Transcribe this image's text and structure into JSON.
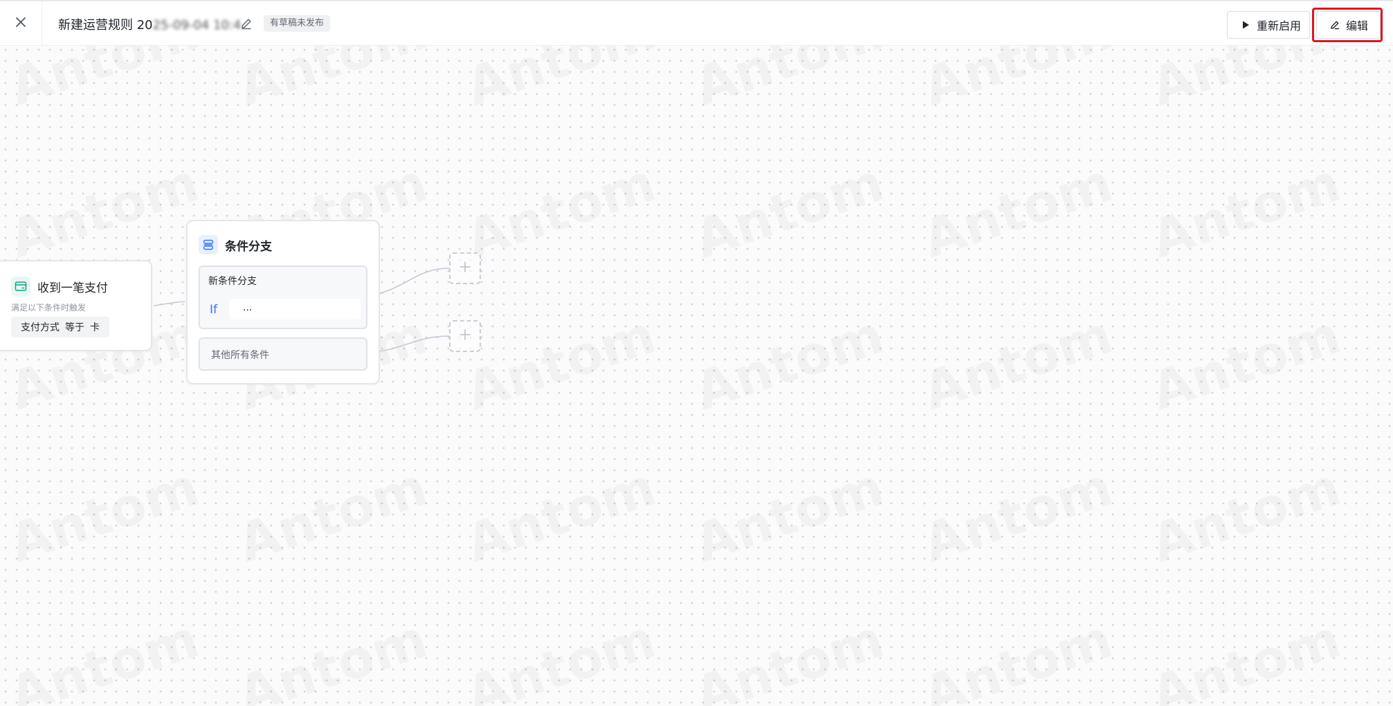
{
  "header": {
    "title_prefix": "新建运营规则 20",
    "title_obscured": "25-09-04 10:4",
    "draft_badge": "有草稿未发布",
    "restart_label": "重新启用",
    "edit_label": "编辑"
  },
  "watermark": {
    "text": "Antom"
  },
  "trigger_node": {
    "title": "收到一笔支付",
    "subtitle": "满足以下条件时触发",
    "condition": {
      "field": "支付方式",
      "operator": "等于",
      "value": "卡"
    }
  },
  "branch_node": {
    "title": "条件分支",
    "branch_title": "新条件分支",
    "if_label": "If",
    "if_value": "...",
    "else_label": "其他所有条件"
  },
  "icons": {
    "close": "close-icon",
    "pencil": "pencil-icon",
    "play": "play-icon",
    "payment": "payment-card-icon",
    "branch": "branch-icon",
    "plus": "plus-icon"
  },
  "colors": {
    "accent": "#3370ff",
    "highlight": "#e0141e",
    "trigger_icon": "#16a085"
  }
}
